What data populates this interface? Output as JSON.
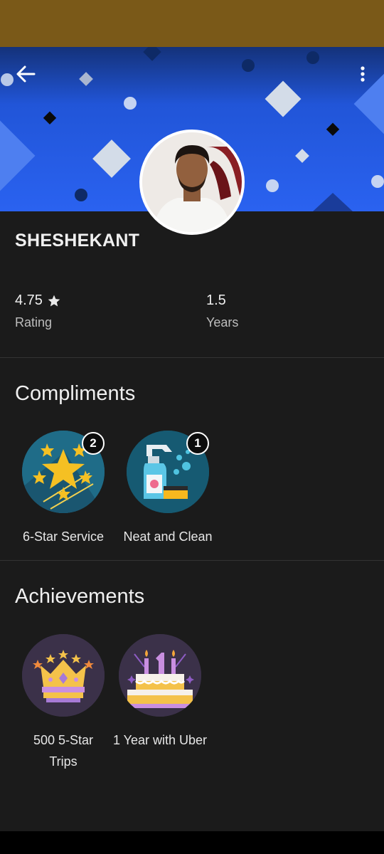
{
  "driver": {
    "name": "SHESHEKANT"
  },
  "stats": [
    {
      "value": "4.75",
      "label": "Rating",
      "icon": "star-icon"
    },
    {
      "value": "1.5",
      "label": "Years"
    }
  ],
  "compliments": {
    "title": "Compliments",
    "items": [
      {
        "label": "6-Star Service",
        "count": "2",
        "icon": "stars-badge-icon"
      },
      {
        "label": "Neat and Clean",
        "count": "1",
        "icon": "cleaning-spray-icon"
      }
    ]
  },
  "achievements": {
    "title": "Achievements",
    "items": [
      {
        "label_line1": "500 5-Star",
        "label_line2": "Trips",
        "icon": "crown-icon"
      },
      {
        "label_line1": "1 Year with Uber",
        "icon": "birthday-cake-icon"
      }
    ]
  },
  "colors": {
    "status_bar": "#7a5918",
    "banner": "#2a62f0",
    "background": "#1b1b1b",
    "compliment_badge_bg": "#1e5a72",
    "achievement_badge_bg": "#3a3048"
  }
}
